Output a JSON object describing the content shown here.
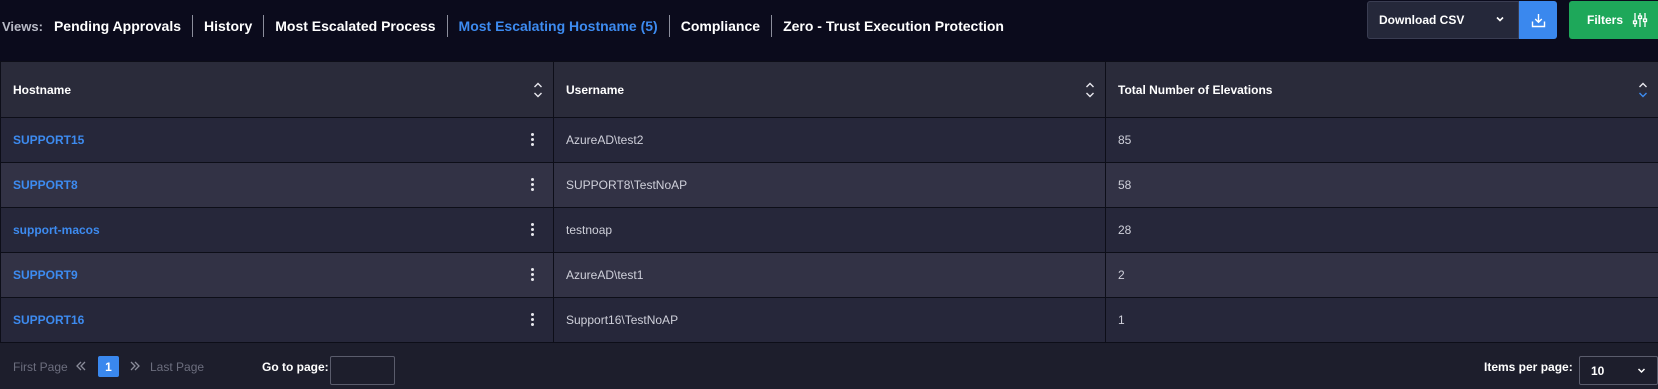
{
  "views": {
    "label": "Views:",
    "tabs": [
      {
        "label": "Pending Approvals",
        "active": false
      },
      {
        "label": "History",
        "active": false
      },
      {
        "label": "Most Escalated Process",
        "active": false
      },
      {
        "label": "Most Escalating Hostname (5)",
        "active": true
      },
      {
        "label": "Compliance",
        "active": false
      },
      {
        "label": "Zero - Trust Execution Protection",
        "active": false
      }
    ]
  },
  "actions": {
    "download_label": "Download CSV",
    "filters_label": "Filters"
  },
  "table": {
    "columns": [
      "Hostname",
      "Username",
      "Total Number of Elevations"
    ],
    "rows": [
      {
        "hostname": "SUPPORT15",
        "username": "AzureAD\\test2",
        "elevations": "85"
      },
      {
        "hostname": "SUPPORT8",
        "username": "SUPPORT8\\TestNoAP",
        "elevations": "58"
      },
      {
        "hostname": "support-macos",
        "username": "testnoap",
        "elevations": "28"
      },
      {
        "hostname": "SUPPORT9",
        "username": "AzureAD\\test1",
        "elevations": "2"
      },
      {
        "hostname": "SUPPORT16",
        "username": "Support16\\TestNoAP",
        "elevations": "1"
      }
    ]
  },
  "pagination": {
    "first_label": "First Page",
    "last_label": "Last Page",
    "current_page": "1",
    "goto_label": "Go to page:",
    "goto_value": "",
    "items_per_page_label": "Items per page:",
    "items_per_page_value": "10"
  },
  "colors": {
    "accent": "#3d8bf0",
    "download_button": "#3a88ee",
    "filters_button": "#1ea85a",
    "background": "#0b0b1c"
  },
  "icons": {
    "download": "download-tray-icon",
    "filters": "sliders-icon",
    "sort": "sort-icon",
    "row_menu": "kebab-menu-icon"
  }
}
